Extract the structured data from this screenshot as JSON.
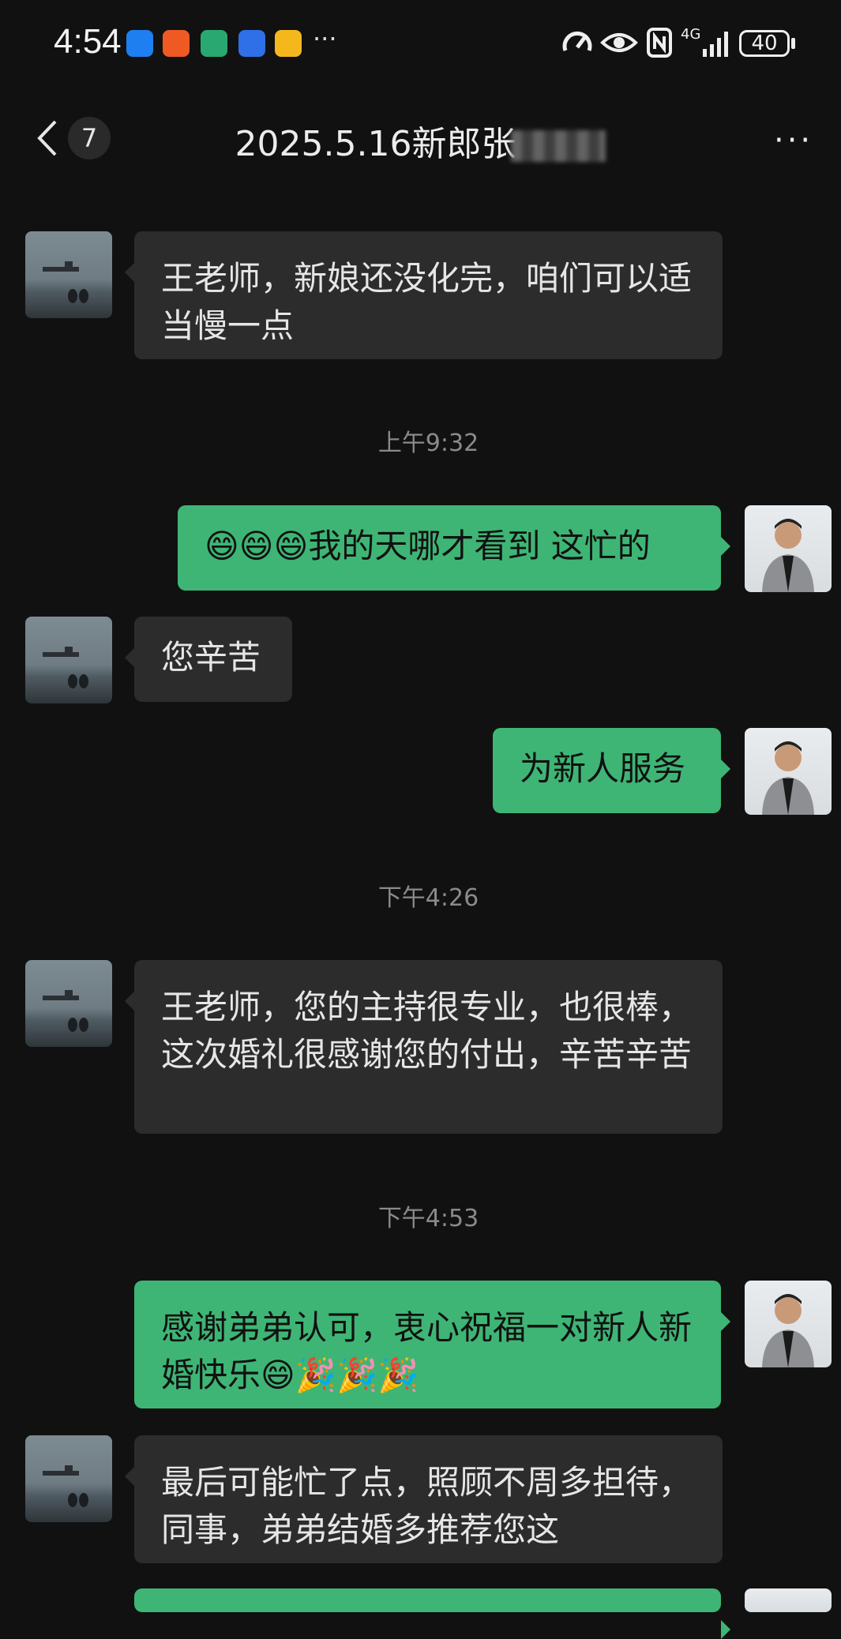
{
  "status_bar": {
    "time": "4:54",
    "more": "···",
    "network": "4G",
    "battery": "40"
  },
  "header": {
    "unread_count": "7",
    "title": "2025.5.16新郎张",
    "more": "···"
  },
  "messages": [
    {
      "side": "in",
      "text": "王老师，新娘还没化完，咱们可以适当慢一点"
    },
    {
      "side": "time",
      "text": "上午9:32"
    },
    {
      "side": "out",
      "text": "😄😄😄我的天哪才看到 这忙的"
    },
    {
      "side": "in",
      "text": "您辛苦"
    },
    {
      "side": "out",
      "text": "为新人服务"
    },
    {
      "side": "time",
      "text": "下午4:26"
    },
    {
      "side": "in",
      "text": "王老师，您的主持很专业，也很棒，这次婚礼很感谢您的付出，辛苦辛苦"
    },
    {
      "side": "time",
      "text": "下午4:53"
    },
    {
      "side": "out",
      "text": "感谢弟弟认可，衷心祝福一对新人新婚快乐😄🎉🎉🎉"
    },
    {
      "side": "in",
      "text": "最后可能忙了点，照顾不周多担待，同事，弟弟结婚多推荐您这"
    }
  ]
}
